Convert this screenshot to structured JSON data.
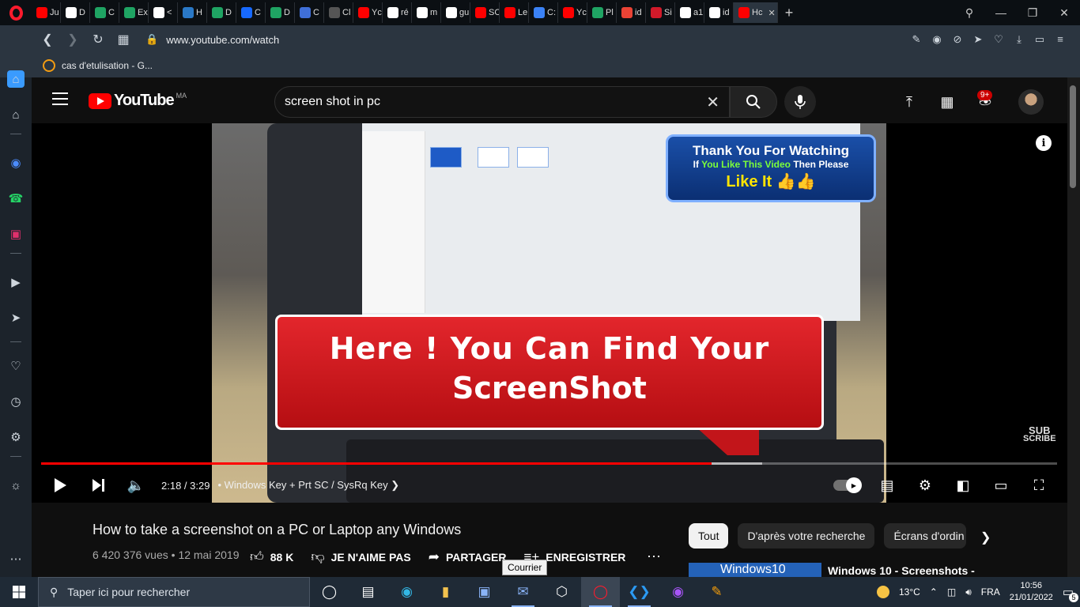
{
  "browser": {
    "tabs": [
      {
        "label": "Ju",
        "icon": "youtube-icon",
        "color": "#ff0000"
      },
      {
        "label": "D",
        "icon": "document-icon",
        "color": "#ffffff"
      },
      {
        "label": "C",
        "icon": "w-icon",
        "color": "#1fa463"
      },
      {
        "label": "Ex",
        "icon": "w-icon",
        "color": "#1fa463"
      },
      {
        "label": "<",
        "icon": "bird-icon",
        "color": "#ffffff"
      },
      {
        "label": "H",
        "icon": "e-icon",
        "color": "#2a78c6"
      },
      {
        "label": "D",
        "icon": "chart-icon",
        "color": "#1fa463"
      },
      {
        "label": "C",
        "icon": "behance-icon",
        "color": "#1769ff"
      },
      {
        "label": "D",
        "icon": "chart-icon",
        "color": "#1fa463"
      },
      {
        "label": "C",
        "icon": "n-icon",
        "color": "#3f6fd8"
      },
      {
        "label": "Cl",
        "icon": "c-icon",
        "color": "#555555"
      },
      {
        "label": "Yc",
        "icon": "youtube-icon",
        "color": "#ff0000"
      },
      {
        "label": "ré",
        "icon": "globe-icon",
        "color": "#ffffff"
      },
      {
        "label": "m",
        "icon": "github-icon",
        "color": "#ffffff"
      },
      {
        "label": "gu",
        "icon": "google-icon",
        "color": "#ffffff"
      },
      {
        "label": "SC",
        "icon": "youtube-icon",
        "color": "#ff0000"
      },
      {
        "label": "Le",
        "icon": "youtube-icon",
        "color": "#ff0000"
      },
      {
        "label": "C:",
        "icon": "shield-icon",
        "color": "#3b82f6"
      },
      {
        "label": "Yc",
        "icon": "youtube-icon",
        "color": "#ff0000"
      },
      {
        "label": "Pl",
        "icon": "w-icon",
        "color": "#1fa463"
      },
      {
        "label": "id",
        "icon": "gmail-icon",
        "color": "#ea4335"
      },
      {
        "label": "Si",
        "icon": "stop-icon",
        "color": "#d11a2a"
      },
      {
        "label": "a1",
        "icon": "globe-icon",
        "color": "#ffffff"
      },
      {
        "label": "id",
        "icon": "github-icon",
        "color": "#ffffff"
      },
      {
        "label": "Hc",
        "icon": "youtube-icon",
        "color": "#ff0000",
        "active": true
      }
    ],
    "url": "www.youtube.com/watch",
    "bookmark": "cas d'etulisation - G..."
  },
  "youtube": {
    "logo_text": "YouTube",
    "country": "MA",
    "search_query": "screen shot in pc",
    "notifications": "9+"
  },
  "video_overlay": {
    "thanks_line1": "Thank You For Watching",
    "thanks_line2_pre": "If",
    "thanks_line2_green": "You Like This Video",
    "thanks_line2_post": "Then Please",
    "thanks_line3": "Like It 👍👍",
    "banner_line1": "Here ! You Can Find Your",
    "banner_line2": "ScreenShot",
    "watermark_top": "SUB",
    "watermark_bottom": "SCRIBE"
  },
  "player": {
    "time": "2:18 / 3:29",
    "chapter": "Windows Key + Prt SC / SysRq Key",
    "progress_fraction": 0.66,
    "buffered_fraction": 0.71
  },
  "video": {
    "title": "How to take a screenshot on a PC or Laptop any Windows",
    "views": "6 420 376 vues",
    "date": "12 mai 2019",
    "likes": "88 K",
    "dislike": "JE N'AIME PAS",
    "share": "PARTAGER",
    "save": "ENREGISTRER"
  },
  "chips": [
    "Tout",
    "D'après votre recherche",
    "Écrans d'ordin"
  ],
  "recommendation": {
    "thumb_text": "Windows10",
    "title": "Windows 10 - Screenshots -"
  },
  "tooltip": "Courrier",
  "taskbar": {
    "search_placeholder": "Taper ici pour rechercher",
    "temperature": "13°C",
    "language": "FRA",
    "time": "10:56",
    "date": "21/01/2022",
    "notification_count": "5"
  }
}
